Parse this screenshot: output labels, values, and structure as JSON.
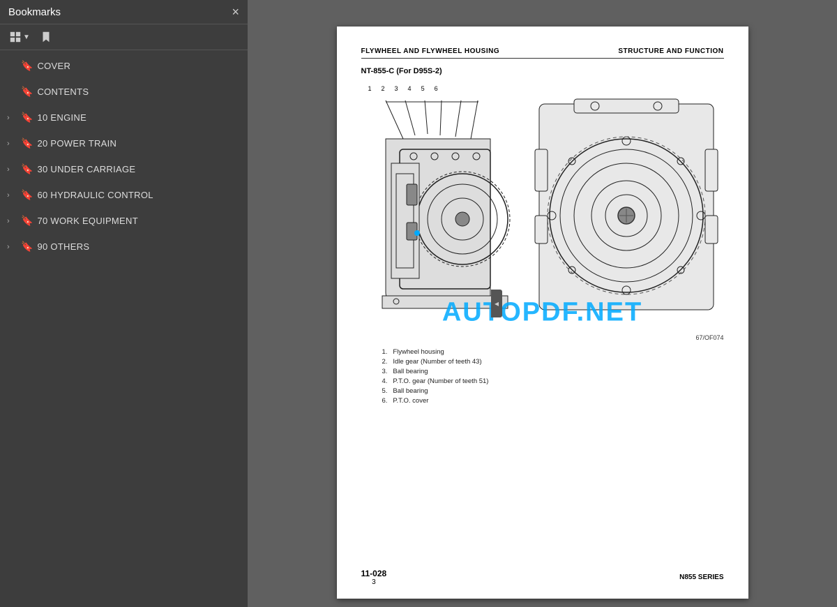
{
  "sidebar": {
    "title": "Bookmarks",
    "close_label": "×",
    "items": [
      {
        "id": "cover",
        "label": "COVER",
        "has_chevron": false
      },
      {
        "id": "contents",
        "label": "CONTENTS",
        "has_chevron": false
      },
      {
        "id": "engine",
        "label": "10 ENGINE",
        "has_chevron": true
      },
      {
        "id": "power-train",
        "label": "20 POWER TRAIN",
        "has_chevron": true
      },
      {
        "id": "under-carriage",
        "label": "30 UNDER CARRIAGE",
        "has_chevron": true
      },
      {
        "id": "hydraulic",
        "label": "60 HYDRAULIC CONTROL",
        "has_chevron": true
      },
      {
        "id": "work-equipment",
        "label": "70 WORK EQUIPMENT",
        "has_chevron": true
      },
      {
        "id": "others",
        "label": "90 OTHERS",
        "has_chevron": true
      }
    ]
  },
  "page": {
    "header_left": "FLYWHEEL AND FLYWHEEL HOUSING",
    "header_right": "STRUCTURE AND FUNCTION",
    "section_title": "NT-855-C (For D95S-2)",
    "num_labels": [
      "1",
      "2",
      "3",
      "4",
      "5",
      "6"
    ],
    "image_code": "67/OF074",
    "parts": [
      {
        "num": "1.",
        "desc": "Flywheel housing"
      },
      {
        "num": "2.",
        "desc": "Idle gear (Number of teeth 43)"
      },
      {
        "num": "3.",
        "desc": "Ball bearing"
      },
      {
        "num": "4.",
        "desc": "P.T.O. gear (Number of teeth  51)"
      },
      {
        "num": "5.",
        "desc": "Ball bearing"
      },
      {
        "num": "6.",
        "desc": "P.T.O. cover"
      }
    ],
    "footer_page_main": "11-028",
    "footer_page_sub": "3",
    "footer_series": "N855 SERIES"
  },
  "watermark": "AUTOPDF.NET"
}
